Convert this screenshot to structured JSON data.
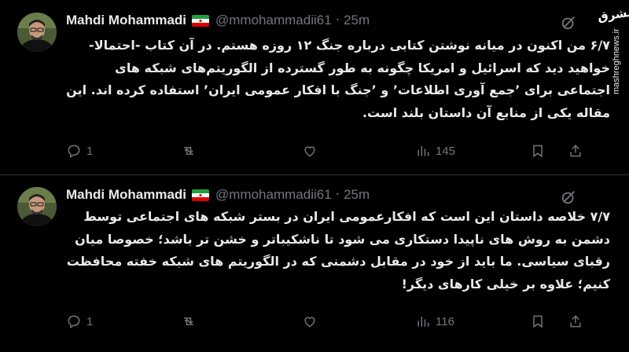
{
  "tweets": [
    {
      "author_name": "Mahdi Mohammadi",
      "flag": "iran-flag",
      "handle": "@mmohammadii61",
      "separator": "·",
      "time": "25m",
      "text": "۶/۷ من اکنون در میانه نوشتن کتابی درباره جنگ ۱۲ روزه هستم. در آن کتاب -احتمالا- خواهید دید که اسرائیل و امریکا چگونه به طور گسترده از الگوریتم‌های شبکه های اجتماعی برای ’جمع آوری اطلاعات’ و ’جنگ با افکار عمومی ایران’ استفاده کرده اند. این مقاله یکی از منابع آن داستان بلند است.",
      "actions": {
        "replies": "1",
        "retweets": "",
        "likes": "",
        "views": "145"
      }
    },
    {
      "author_name": "Mahdi Mohammadi",
      "flag": "iran-flag",
      "handle": "@mmohammadii61",
      "separator": "·",
      "time": "25m",
      "text": "۷/۷ خلاصه داستان این است که افکارعمومی ایران در بستر شبکه های اجتماعی توسط دشمن به روش های ناپیدا دستکاری می شود تا ناشکیباتر و خشن تر باشد؛ خصوصا میان رقبای سیاسی. ما باید از خود در مقابل دشمنی که در الگوریتم های شبکه خفته محافظت کنیم؛ علاوه بر خیلی کارهای دیگر!",
      "actions": {
        "replies": "1",
        "retweets": "",
        "likes": "",
        "views": "116"
      }
    }
  ],
  "watermark": {
    "logo": "مشرق",
    "url": "mashreghnews.ir"
  },
  "colors": {
    "background": "#000000",
    "text": "#e7e9ea",
    "muted": "#71767b",
    "divider": "#2f3336"
  },
  "icons": [
    "reply-icon",
    "retweet-icon",
    "like-icon",
    "views-icon",
    "bookmark-icon",
    "share-icon",
    "grok-icon"
  ]
}
